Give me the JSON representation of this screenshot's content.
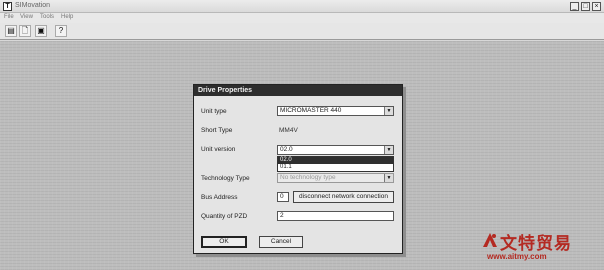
{
  "window": {
    "title": "SIMovation",
    "icon_glyph": "T",
    "minimize_glyph": "_",
    "maximize_glyph": "□",
    "close_glyph": "×"
  },
  "menu": [
    "File",
    "View",
    "Tools",
    "Help"
  ],
  "toolbar": {
    "new_glyph": "▤",
    "open_glyph": "🗋",
    "save_glyph": "▣",
    "help_glyph": "?"
  },
  "dialog": {
    "title": "Drive Properties",
    "unit_type_label": "Unit type",
    "unit_type_value": "MICROMASTER 440",
    "short_type_label": "Short Type",
    "short_type_value": "MM4V",
    "unit_version_label": "Unit version",
    "unit_version_value": "02.0",
    "version_options": [
      "02.0",
      "01.1"
    ],
    "version_selected": "02.0",
    "technology_type_label": "Technology Type",
    "technology_type_value": "No technology type",
    "bus_address_label": "Bus Address",
    "bus_address_value": "0",
    "disconnect_label": "disconnect network connection",
    "pzd_label": "Quantity of PZD",
    "pzd_value": "2",
    "ok_label": "OK",
    "cancel_label": "Cancel",
    "dropdown_arrow": "▼"
  },
  "watermark": {
    "text_cn": "文特贸易",
    "url": "www.aitmy.com",
    "color": "#b42a22"
  }
}
